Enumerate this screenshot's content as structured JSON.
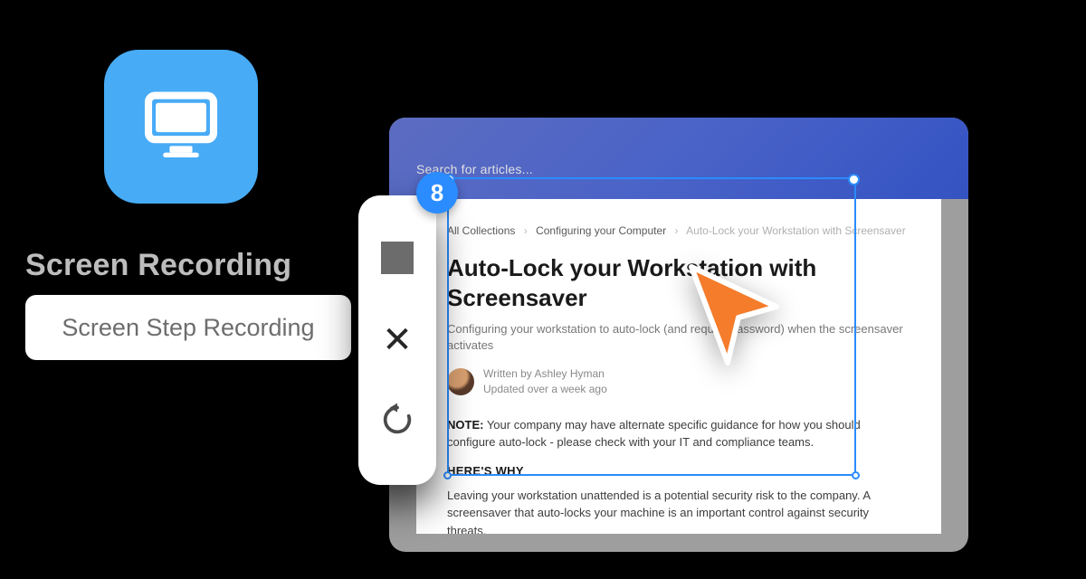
{
  "left_panel": {
    "heading": "Screen Recording",
    "card_label": "Screen Step Recording"
  },
  "recorder": {
    "step_count": "8"
  },
  "browser": {
    "search_placeholder": "Search for articles..."
  },
  "article": {
    "breadcrumbs": {
      "root": "All Collections",
      "section": "Configuring your Computer",
      "current": "Auto-Lock your Workstation with Screensaver"
    },
    "title": "Auto-Lock your Workstation with Screensaver",
    "subtitle": "Configuring your workstation to auto-lock (and require password) when the screensaver activates",
    "author_name": "Ashley Hyman",
    "written_by_prefix": "Written by ",
    "updated": "Updated over a week ago",
    "note_label": "NOTE:",
    "note_body": " Your company may have alternate specific guidance for how you should configure auto-lock - please check with your IT and compliance teams.",
    "why_heading": "HERE'S WHY",
    "why_body": "Leaving your workstation unattended is a potential security risk to the company. A screensaver that auto-locks your machine is an important control against security threats."
  }
}
